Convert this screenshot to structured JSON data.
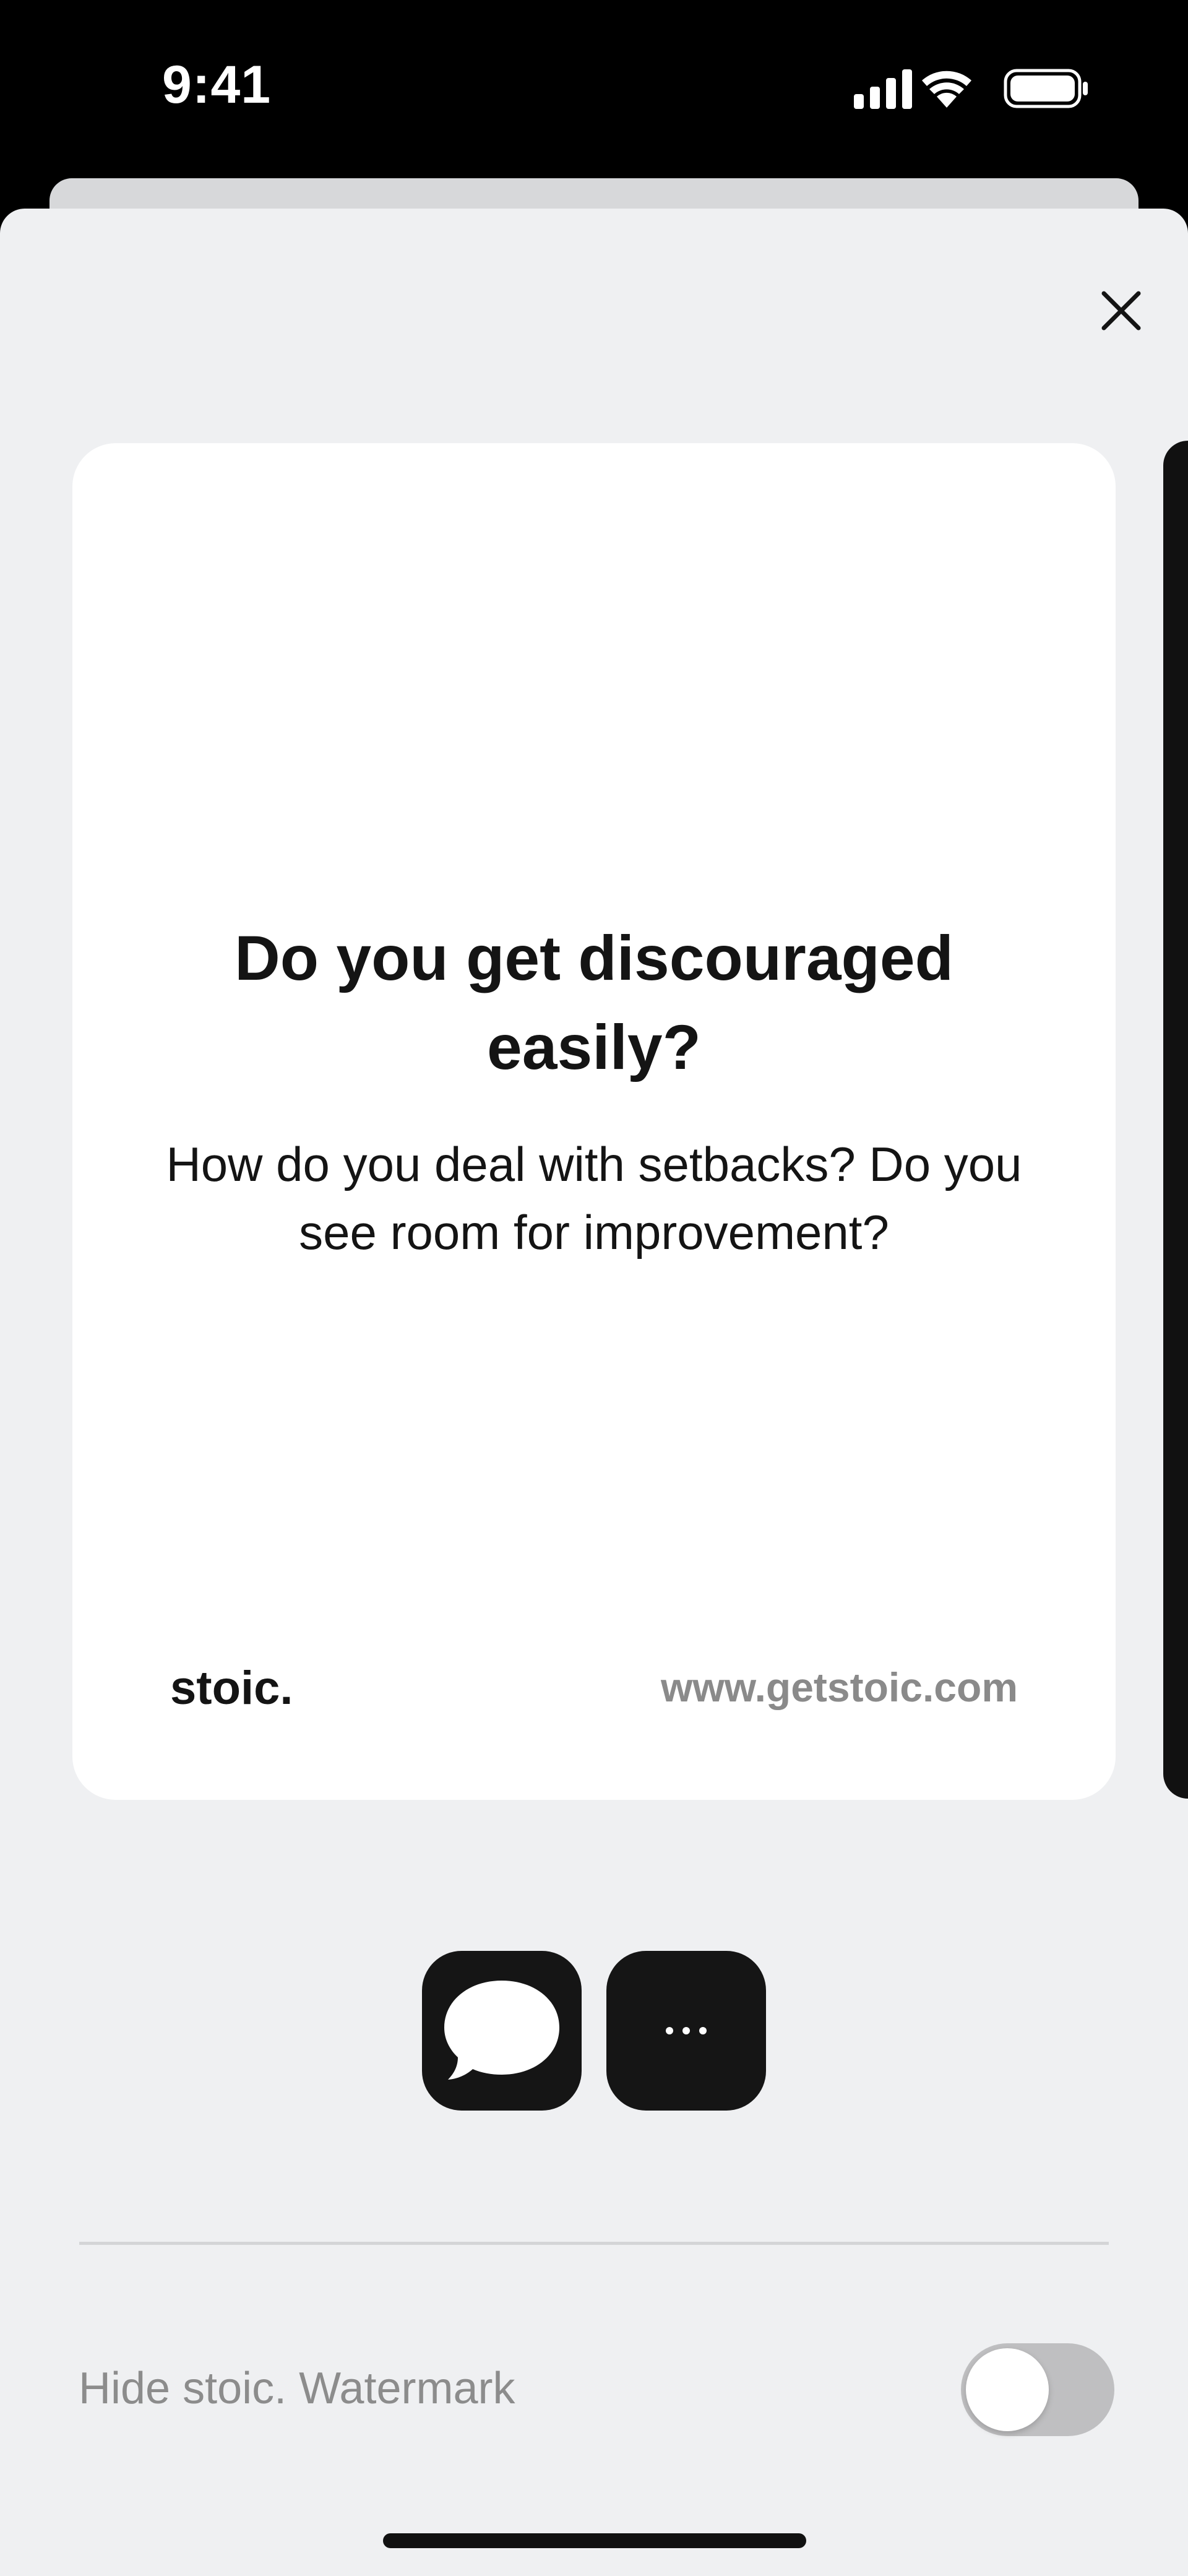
{
  "status_bar": {
    "time": "9:41",
    "icons": [
      "signal-icon",
      "wifi-icon",
      "battery-icon"
    ]
  },
  "card": {
    "title": "Do you get discouraged easily?",
    "subtitle": "How do you deal with setbacks? Do you see room for improvement?",
    "brand": "stoic.",
    "url": "www.getstoic.com"
  },
  "share_actions": {
    "messages_icon": "speech-bubble-icon",
    "more_icon": "ellipsis-icon",
    "more_label": "…"
  },
  "settings": {
    "hide_watermark_label": "Hide stoic. Watermark",
    "hide_watermark_enabled": false
  },
  "colors": {
    "sheet_background": "#eff0f2",
    "card_background": "#ffffff",
    "button_background": "#151515",
    "toggle_off": "#bfbfc1",
    "muted_text": "#8c8c8c"
  }
}
